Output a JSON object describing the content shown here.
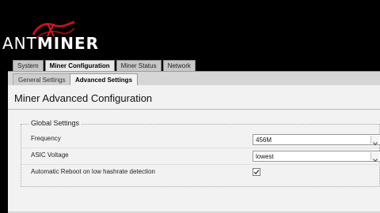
{
  "brand": {
    "logo_text_thin": "ANT",
    "logo_text_bold": "MINER",
    "logo_accent_color": "#c0121b"
  },
  "main_tabs": [
    {
      "label": "System",
      "active": false
    },
    {
      "label": "Miner Configuration",
      "active": true
    },
    {
      "label": "Miner Status",
      "active": false
    },
    {
      "label": "Network",
      "active": false
    }
  ],
  "sub_tabs": [
    {
      "label": "General Settings",
      "active": false
    },
    {
      "label": "Advanced Settings",
      "active": true
    }
  ],
  "page": {
    "title": "Miner Advanced Configuration"
  },
  "global_settings": {
    "legend": "Global Settings",
    "frequency": {
      "label": "Frequency",
      "value": "456M"
    },
    "asic_voltage": {
      "label": "ASIC Voltage",
      "value": "lowest"
    },
    "auto_reboot": {
      "label": "Automatic Reboot on low hashrate detection",
      "checked": true
    }
  },
  "icons": {
    "select_arrow": "chevron-down-icon",
    "checkbox_mark": "check-icon"
  }
}
